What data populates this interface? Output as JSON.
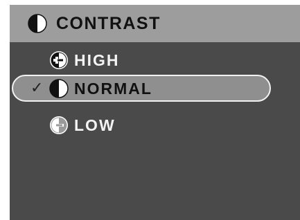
{
  "menu": {
    "title": "CONTRAST",
    "title_icon": "contrast-half-circle-icon",
    "items": [
      {
        "label": "HIGH",
        "icon": "contrast-high-icon",
        "selected": false
      },
      {
        "label": "NORMAL",
        "icon": "contrast-normal-icon",
        "selected": true,
        "check_mark": "✓"
      },
      {
        "label": "LOW",
        "icon": "contrast-low-icon",
        "selected": false
      }
    ]
  },
  "colors": {
    "background": "#4a4a4a",
    "header": "#9d9d9d",
    "selection": "#8f8f8f",
    "text_light": "#f4f4f4",
    "text_dark": "#111111"
  }
}
